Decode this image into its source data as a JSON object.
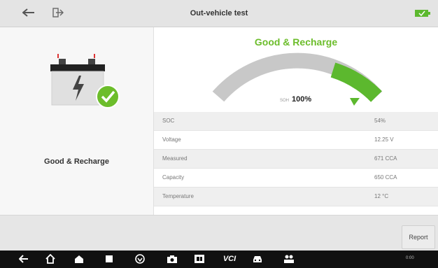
{
  "header": {
    "title": "Out-vehicle test",
    "back_icon": "back-arrow-icon",
    "exit_icon": "exit-icon",
    "battery_icon": "battery-status-icon"
  },
  "left_panel": {
    "result_label": "Good & Recharge",
    "battery_icon": "battery-icon",
    "check_icon": "check-icon"
  },
  "gauge": {
    "title": "Good & Recharge",
    "soh_label": "SOH",
    "soh_value": "100%",
    "soh_fraction": 1.0
  },
  "results": [
    {
      "label": "SOC",
      "value": "54%"
    },
    {
      "label": "Voltage",
      "value": "12.25 V"
    },
    {
      "label": "Measured",
      "value": "671 CCA"
    },
    {
      "label": "Capacity",
      "value": "650 CCA"
    },
    {
      "label": "Temperature",
      "value": "12 °C"
    }
  ],
  "footer": {
    "report_label": "Report"
  },
  "navbar": {
    "icons": [
      "back-icon",
      "home-icon",
      "house-icon",
      "recent-apps-icon",
      "shield-icon",
      "camera-icon",
      "display-icon",
      "vci-icon",
      "car-icon",
      "people-icon"
    ],
    "vci_label": "VCI",
    "status_text": "0:00"
  },
  "colors": {
    "accent": "#6cbd2b",
    "gauge_gray": "#c8c8c8"
  }
}
